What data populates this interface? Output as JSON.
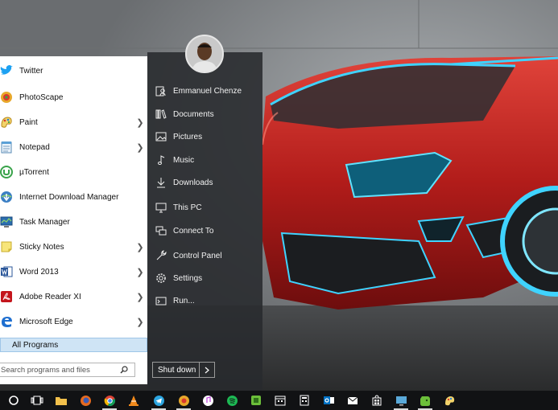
{
  "start_menu": {
    "programs": [
      {
        "label": "Twitter",
        "icon": "twitter-icon",
        "has_submenu": false
      },
      {
        "label": "PhotoScape",
        "icon": "photoscape-icon",
        "has_submenu": false
      },
      {
        "label": "Paint",
        "icon": "paint-icon",
        "has_submenu": true
      },
      {
        "label": "Notepad",
        "icon": "notepad-icon",
        "has_submenu": true
      },
      {
        "label": "µTorrent",
        "icon": "utorrent-icon",
        "has_submenu": false
      },
      {
        "label": "Internet Download Manager",
        "icon": "idm-icon",
        "has_submenu": false
      },
      {
        "label": "Task Manager",
        "icon": "task-manager-icon",
        "has_submenu": false
      },
      {
        "label": "Sticky Notes",
        "icon": "sticky-notes-icon",
        "has_submenu": true
      },
      {
        "label": "Word 2013",
        "icon": "word-icon",
        "has_submenu": true
      },
      {
        "label": "Adobe Reader XI",
        "icon": "adobe-reader-icon",
        "has_submenu": true
      },
      {
        "label": "Microsoft Edge",
        "icon": "edge-icon",
        "has_submenu": true
      }
    ],
    "all_programs_label": "All Programs",
    "search_placeholder": "Search programs and files",
    "places": [
      {
        "label": "Emmanuel Chenze",
        "icon": "user-icon"
      },
      {
        "label": "Documents",
        "icon": "documents-icon"
      },
      {
        "label": "Pictures",
        "icon": "pictures-icon"
      },
      {
        "label": "Music",
        "icon": "music-icon"
      },
      {
        "label": "Downloads",
        "icon": "downloads-icon"
      },
      {
        "label": "This PC",
        "icon": "computer-icon"
      },
      {
        "label": "Connect To",
        "icon": "connect-icon"
      },
      {
        "label": "Control Panel",
        "icon": "control-panel-icon"
      },
      {
        "label": "Settings",
        "icon": "gear-icon"
      },
      {
        "label": "Run...",
        "icon": "run-icon"
      }
    ],
    "shutdown_label": "Shut down"
  },
  "taskbar": {
    "items": [
      {
        "name": "cortana-icon",
        "active": false
      },
      {
        "name": "task-view-icon",
        "active": false
      },
      {
        "name": "file-explorer-icon",
        "active": false
      },
      {
        "name": "firefox-icon",
        "active": false
      },
      {
        "name": "chrome-icon",
        "active": true
      },
      {
        "name": "vlc-icon",
        "active": false
      },
      {
        "name": "telegram-icon",
        "active": true
      },
      {
        "name": "photoscape-taskbar-icon",
        "active": true
      },
      {
        "name": "itunes-icon",
        "active": false
      },
      {
        "name": "spotify-icon",
        "active": false
      },
      {
        "name": "green-app-icon",
        "active": false
      },
      {
        "name": "calendar-icon",
        "active": false
      },
      {
        "name": "calculator-icon",
        "active": false
      },
      {
        "name": "outlook-icon",
        "active": false
      },
      {
        "name": "mail-icon",
        "active": false
      },
      {
        "name": "store-icon",
        "active": false
      },
      {
        "name": "monitor-app-icon",
        "active": true
      },
      {
        "name": "evernote-icon",
        "active": true
      },
      {
        "name": "paint-taskbar-icon",
        "active": false
      }
    ]
  },
  "colors": {
    "accent": "#cfe4f5",
    "panel_dark": "#282a2d",
    "taskbar": "#111214",
    "car_red": "#c0211f",
    "neon_blue": "#3fd3ff"
  }
}
